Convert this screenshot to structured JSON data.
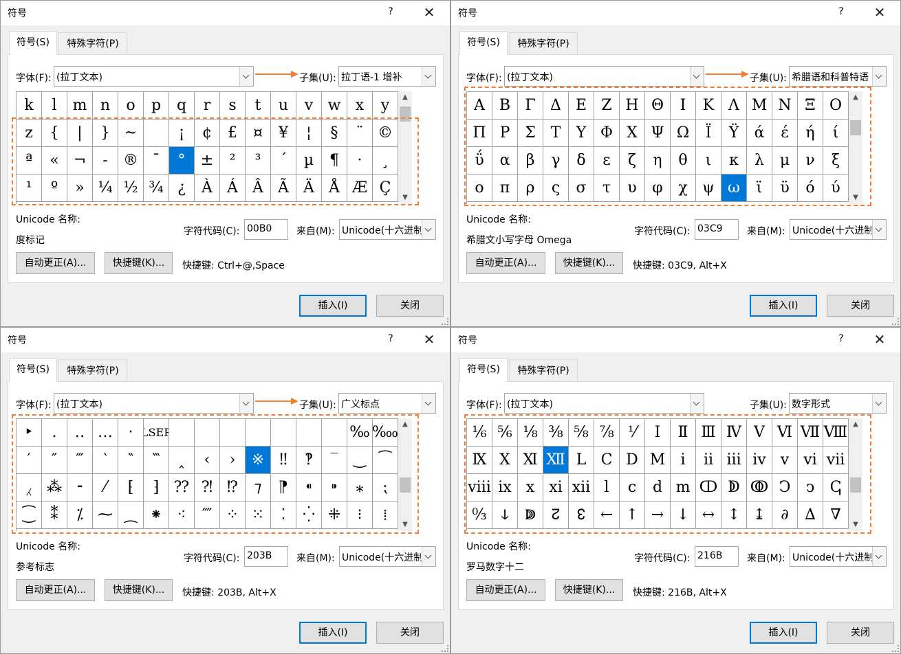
{
  "common": {
    "title": "符号",
    "help": "?",
    "close_glyph": "✕",
    "tab_symbols": "符号(S)",
    "tab_special": "特殊字符(P)",
    "font_label": "字体(F):",
    "subset_label": "子集(U):",
    "unicode_name_label": "Unicode 名称:",
    "char_code_label": "字符代码(C):",
    "from_label": "来自(M):",
    "from_value": "Unicode(十六进制)",
    "autocorrect_button": "自动更正(A)...",
    "shortcut_key_button": "快捷键(K)...",
    "insert_button": "插入(I)",
    "close_button": "关闭",
    "scroll_up": "▲",
    "scroll_down": "▼"
  },
  "accent_color": "#0078d7",
  "highlight_color": "#f07f33",
  "dialogs": [
    {
      "font_value": "(拉丁文本)",
      "subset_value": "拉丁语-1 增补",
      "unicode_name": "度标记",
      "char_code": "00B0",
      "shortcut_text": "快捷键: Ctrl+@,Space",
      "selected_index": 36,
      "cells": [
        "k",
        "l",
        "m",
        "n",
        "o",
        "p",
        "q",
        "r",
        "s",
        "t",
        "u",
        "v",
        "w",
        "x",
        "y",
        "z",
        "{",
        "|",
        "}",
        "~",
        "",
        "¡",
        "¢",
        "£",
        "¤",
        "¥",
        "¦",
        "§",
        "¨",
        "©",
        "ª",
        "«",
        "¬",
        "-",
        "®",
        "¯",
        "°",
        "±",
        "²",
        "³",
        "´",
        "µ",
        "¶",
        "·",
        "¸",
        "¹",
        "º",
        "»",
        "¼",
        "½",
        "¾",
        "¿",
        "À",
        "Á",
        "Â",
        "Ã",
        "Ä",
        "Å",
        "Æ",
        "Ç"
      ]
    },
    {
      "font_value": "(拉丁文本)",
      "subset_value": "希腊语和科普特语",
      "unicode_name": "希腊文小写字母 Omega",
      "char_code": "03C9",
      "shortcut_text": "快捷键: 03C9, Alt+X",
      "selected_index": 55,
      "cells": [
        "Α",
        "Β",
        "Γ",
        "Δ",
        "Ε",
        "Ζ",
        "Η",
        "Θ",
        "Ι",
        "Κ",
        "Λ",
        "Μ",
        "Ν",
        "Ξ",
        "Ο",
        "Π",
        "Ρ",
        "Σ",
        "Τ",
        "Υ",
        "Φ",
        "Χ",
        "Ψ",
        "Ω",
        "Ϊ",
        "Ϋ",
        "ά",
        "έ",
        "ή",
        "ί",
        "ΰ",
        "α",
        "β",
        "γ",
        "δ",
        "ε",
        "ζ",
        "η",
        "θ",
        "ι",
        "κ",
        "λ",
        "μ",
        "ν",
        "ξ",
        "ο",
        "π",
        "ρ",
        "ς",
        "σ",
        "τ",
        "υ",
        "φ",
        "χ",
        "ψ",
        "ω",
        "ϊ",
        "ϋ",
        "ό",
        "ύ"
      ]
    },
    {
      "font_value": "(拉丁文本)",
      "subset_value": "广义标点",
      "unicode_name": "参考标志",
      "char_code": "203B",
      "shortcut_text": "快捷键: 203B, Alt+X",
      "selected_index": 24,
      "cells": [
        "‣",
        "․",
        "‥",
        "…",
        "‧",
        "LSEP",
        "",
        "",
        "",
        "",
        "",
        "",
        "",
        "‰",
        "‱",
        "′",
        "″",
        "‴",
        "‵",
        "‶",
        "‷",
        "‸",
        "‹",
        "›",
        "※",
        "‼",
        "‽",
        "‾",
        "‿",
        "⁀",
        "⁁",
        "⁂",
        "⁃",
        "⁄",
        "⁅",
        "⁆",
        "⁇",
        "⁈",
        "⁉",
        "⁊",
        "⁋",
        "⁌",
        "⁍",
        "⁎",
        "⁏",
        "⁐",
        "⁑",
        "⁒",
        "⁓",
        "⁔",
        "⁕",
        "⁖",
        "⁗",
        "⁘",
        "⁙",
        "⁚",
        "⁛",
        "⁜",
        "⁝",
        "⁞"
      ]
    },
    {
      "font_value": "(拉丁文本)",
      "subset_value": "数字形式",
      "unicode_name": "罗马数字十二",
      "char_code": "216B",
      "shortcut_text": "快捷键: 216B, Alt+X",
      "selected_index": 18,
      "cells": [
        "⅙",
        "⅚",
        "⅛",
        "⅜",
        "⅝",
        "⅞",
        "⅟",
        "Ⅰ",
        "Ⅱ",
        "Ⅲ",
        "Ⅳ",
        "Ⅴ",
        "Ⅵ",
        "Ⅶ",
        "Ⅷ",
        "Ⅸ",
        "Ⅹ",
        "Ⅺ",
        "Ⅻ",
        "Ⅼ",
        "Ⅽ",
        "Ⅾ",
        "Ⅿ",
        "ⅰ",
        "ⅱ",
        "ⅲ",
        "ⅳ",
        "ⅴ",
        "ⅵ",
        "ⅶ",
        "ⅷ",
        "ⅸ",
        "ⅹ",
        "ⅺ",
        "ⅻ",
        "ⅼ",
        "ⅽ",
        "ⅾ",
        "ⅿ",
        "ↀ",
        "ↁ",
        "ↂ",
        "Ↄ",
        "ↄ",
        "ↅ",
        "↉",
        "ↆ",
        "ↇ",
        "↊",
        "↋",
        "←",
        "↑",
        "→",
        "↓",
        "↔",
        "↕",
        "↨",
        "∂",
        "∆",
        "∇"
      ]
    }
  ]
}
